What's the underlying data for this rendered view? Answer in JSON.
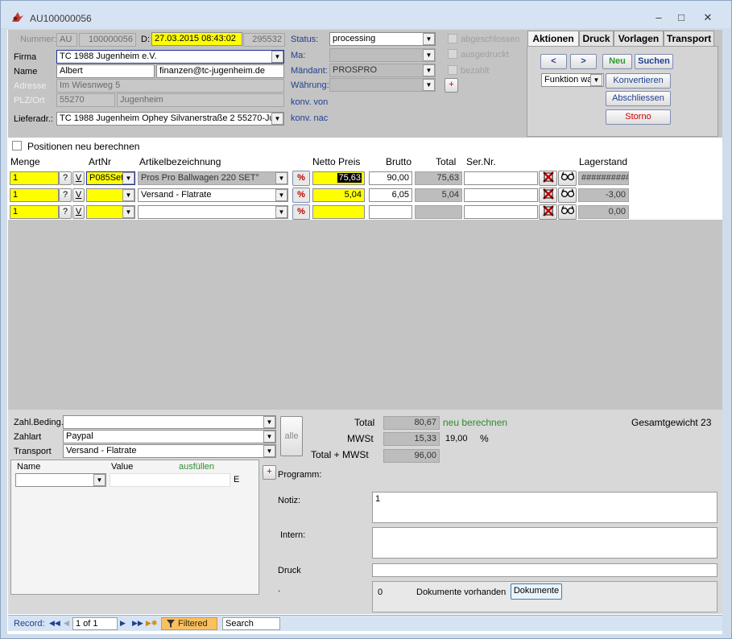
{
  "window": {
    "title": "AU100000056"
  },
  "header": {
    "nummer_label": "Nummer:",
    "nummer_prefix": "AU",
    "nummer_value": "100000056",
    "date_label": "D:",
    "date_value": "27.03.2015 08:43:02",
    "id_value": "295532",
    "firma_label": "Firma",
    "firma_value": "TC 1988 Jugenheim e.V.",
    "name_label": "Name",
    "name_value": "Albert",
    "email_value": "finanzen@tc-jugenheim.de",
    "adresse_label": "Adresse",
    "adresse_value": "Im Wiesnweg 5",
    "plz_label": "PLZ/Ort",
    "plz_value": "55270",
    "ort_value": "Jugenheim",
    "liefer_label": "Lieferadr.:",
    "liefer_value": "TC 1988 Jugenheim Ophey Silvanerstraße 2  55270-Ju",
    "status_label": "Status:",
    "status_value": "processing",
    "ma_label": "Ma:",
    "ma_value": "",
    "mandant_label": "Mändant:",
    "mandant_value": "PROSPRO",
    "waehrung_label": "Währung:",
    "waehrung_value": "",
    "konv_von_label": "konv. von",
    "konv_nach_label": "konv. nac",
    "abgeschlossen_label": "abgeschlossen",
    "ausgedruckt_label": "ausgedruckt",
    "bezahlt_label": "bezahlt",
    "plus_label": "+"
  },
  "tabs": [
    {
      "label": "Aktionen",
      "active": true
    },
    {
      "label": "Druck",
      "active": false
    },
    {
      "label": "Vorlagen",
      "active": false
    },
    {
      "label": "Transport",
      "active": false
    }
  ],
  "actions": {
    "prev_label": "<",
    "next_label": ">",
    "neu_label": "Neu",
    "suchen_label": "Suchen",
    "funktion_value": "Funktion wa",
    "konvertieren_label": "Konvertieren",
    "abschliessen_label": "Abschliessen",
    "storno_label": "Storno"
  },
  "positions": {
    "recalc_label": "Positionen neu berechnen",
    "columns": {
      "menge": "Menge",
      "artnr": "ArtNr",
      "bezeichnung": "Artikelbezeichnung",
      "netto": "Netto Preis",
      "brutto": "Brutto",
      "total": "Total",
      "sernr": "Ser.Nr.",
      "lager": "Lagerstand"
    },
    "q_label": "?",
    "v_label": "V",
    "pct_label": "%",
    "rows": [
      {
        "menge": "1",
        "artnr": "P085Set",
        "bezeichnung": "Pros Pro Ballwagen 220 SET°",
        "netto": "75,63",
        "brutto": "90,00",
        "total": "75,63",
        "sernr": "",
        "lager": "##########"
      },
      {
        "menge": "1",
        "artnr": "",
        "bezeichnung": "Versand - Flatrate",
        "netto": "5,04",
        "brutto": "6,05",
        "total": "5,04",
        "sernr": "",
        "lager": "-3,00"
      },
      {
        "menge": "1",
        "artnr": "",
        "bezeichnung": "",
        "netto": "",
        "brutto": "",
        "total": "",
        "sernr": "",
        "lager": "0,00"
      }
    ]
  },
  "payment": {
    "zahlbed_label": "Zahl.Beding.",
    "zahlbed_value": "",
    "zahlart_label": "Zahlart",
    "zahlart_value": "Paypal",
    "transport_label": "Transport",
    "transport_value": "Versand - Flatrate",
    "alle_label": "alle"
  },
  "totals": {
    "total_label": "Total",
    "total_value": "80,67",
    "neu_berechnen_label": "neu berechnen",
    "mwst_label": "MWSt",
    "mwst_value": "15,33",
    "mwst_rate": "19,00",
    "percent_sign": "%",
    "total_mwst_label": "Total + MWSt",
    "total_mwst_value": "96,00",
    "gesamtgewicht_label": "Gesamtgewicht",
    "gesamtgewicht_value": "23"
  },
  "nvp": {
    "name_col": "Name",
    "value_col": "Value",
    "ausfuellen_label": "ausfüllen",
    "e_label": "E",
    "plus_label": "+",
    "programm_label": "Programm:"
  },
  "notes": {
    "notiz_label": "Notiz:",
    "notiz_value": "1",
    "intern_label": "Intern:",
    "intern_value": "",
    "druck_label": "Druck",
    "druck_value": "",
    "dot_label": ".",
    "dok_count": "0",
    "dok_vorhanden_label": "Dokumente vorhanden",
    "dokumente_button": "Dokumente"
  },
  "statusbar": {
    "record_label": "Record:",
    "record_value": "1 of 1",
    "filtered_label": "Filtered",
    "search_label": "Search"
  },
  "colors": {
    "accent_yellow": "#ffff00",
    "panel_grey": "#c4c4c4",
    "link_blue": "#1f3f8f",
    "green_text": "#2e8b2e",
    "red_text": "#d00000"
  }
}
